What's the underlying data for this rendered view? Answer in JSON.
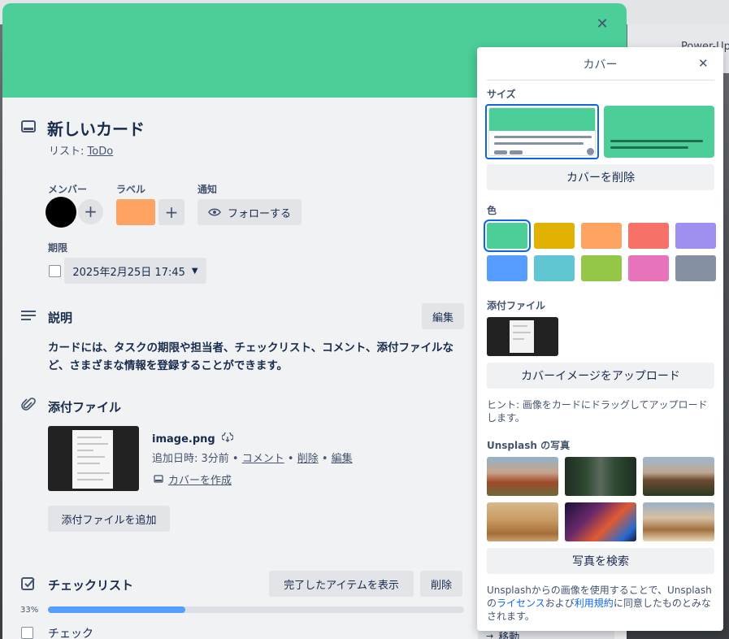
{
  "card": {
    "title": "新しいカード",
    "list_prefix": "リスト: ",
    "list_name": "ToDo",
    "cover_color": "#4bce97",
    "members_label": "メンバー",
    "labels_label": "ラベル",
    "label_color": "#fea362",
    "notifications_label": "通知",
    "follow_button": "フォローする",
    "due_label": "期限",
    "due_value": "2025年2月25日 17:45",
    "description_heading": "説明",
    "edit_button": "編集",
    "description_text": "カードには、タスクの期限や担当者、チェックリスト、コメント、添付ファイルなど、さまざまな情報を登録することができます。",
    "attachments_heading": "添付ファイル",
    "attachment": {
      "name": "image.png",
      "added_prefix": "追加日時: 3分前 •",
      "comment": "コメント",
      "delete": "削除",
      "edit": "編集",
      "make_cover": "カバーを作成"
    },
    "add_attachment_button": "添付ファイルを追加",
    "checklist_heading": "チェックリスト",
    "show_checked_button": "完了したアイテムを表示",
    "delete_button": "削除",
    "progress_percent": 33,
    "progress_label": "33%",
    "checklist_item": "チェック",
    "partial_move_label": "移動"
  },
  "background": {
    "right_text": "Power-Ups"
  },
  "cover_popover": {
    "title": "カバー",
    "size_heading": "サイズ",
    "remove_cover_button": "カバーを削除",
    "color_heading": "色",
    "colors": [
      "#4bce97",
      "#e2b203",
      "#fea362",
      "#f87168",
      "#9f8fef",
      "#579dff",
      "#60c6d2",
      "#94c748",
      "#e774bb",
      "#8590a2"
    ],
    "selected_color_index": 0,
    "attachments_heading": "添付ファイル",
    "upload_button": "カバーイメージをアップロード",
    "hint": "ヒント: 画像をカードにドラッグしてアップロードします。",
    "unsplash_heading": "Unsplash の写真",
    "search_photos_button": "写真を検索",
    "legal_prefix": "Unsplashからの画像を使用することで、Unsplashの",
    "license_link": "ライセンス",
    "legal_and": "および",
    "terms_link": "利用規約",
    "legal_suffix": "に同意したものとみなされます。"
  }
}
